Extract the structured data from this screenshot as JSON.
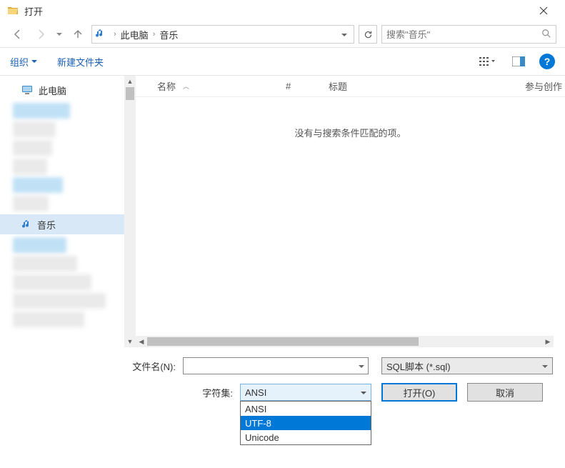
{
  "window": {
    "title": "打开"
  },
  "breadcrumb": {
    "root": "此电脑",
    "current": "音乐"
  },
  "search": {
    "placeholder": "搜索\"音乐\""
  },
  "toolbar": {
    "organize": "组织",
    "new_folder": "新建文件夹"
  },
  "sidebar": {
    "this_pc": "此电脑",
    "music": "音乐"
  },
  "columns": {
    "name": "名称",
    "num": "#",
    "title": "标题",
    "contrib": "参与创作"
  },
  "content": {
    "empty": "没有与搜索条件匹配的项。"
  },
  "footer": {
    "filename_label": "文件名(N):",
    "filetype": "SQL脚本 (*.sql)",
    "charset_label": "字符集:",
    "charset_selected": "ANSI",
    "charset_options": [
      "ANSI",
      "UTF-8",
      "Unicode"
    ],
    "open": "打开(O)",
    "cancel": "取消"
  }
}
